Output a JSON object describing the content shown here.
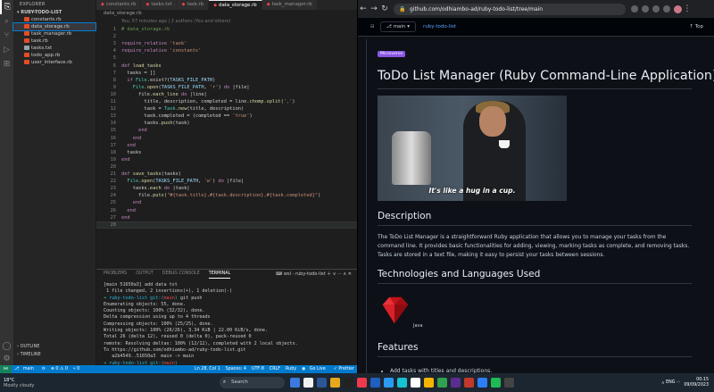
{
  "vscode": {
    "activity_icons": [
      "files-icon",
      "search-icon",
      "source-control-icon",
      "run-icon",
      "extensions-icon",
      "account-icon",
      "settings-icon"
    ],
    "explorer_title": "EXPLORER",
    "root_folder": "RUBY-TODO-LIST",
    "files": [
      {
        "name": "constants.rb",
        "color": "#e44d26"
      },
      {
        "name": "data_storage.rb",
        "color": "#e44d26",
        "selected": true
      },
      {
        "name": "task_manager.rb",
        "color": "#e44d26"
      },
      {
        "name": "task.rb",
        "color": "#e44d26"
      },
      {
        "name": "tasks.txt",
        "color": "#9aa3ab"
      },
      {
        "name": "todo_app.rb",
        "color": "#e44d26"
      },
      {
        "name": "user_interface.rb",
        "color": "#e44d26"
      }
    ],
    "outline_label": "OUTLINE",
    "timeline_label": "TIMELINE",
    "tabs": [
      {
        "label": "constants.rb"
      },
      {
        "label": "tasks.txt"
      },
      {
        "label": "task.rb"
      },
      {
        "label": "data_storage.rb",
        "active": true
      },
      {
        "label": "task_manager.rb"
      }
    ],
    "breadcrumb": "data_storage.rb",
    "blame": "You, 57 minutes ago | 2 authors (You and others)",
    "code_lines": [
      "# data_storage.rb",
      "",
      "require_relative 'task'",
      "require_relative 'constants'",
      "",
      "def load_tasks",
      "  tasks = []",
      "  if File.exist?(TASKS_FILE_PATH)",
      "    File.open(TASKS_FILE_PATH, 'r') do |file|",
      "      file.each_line do |line|",
      "        title, description, completed = line.chomp.split(',')",
      "        task = Task.new(title, description)",
      "        task.completed = (completed == 'true')",
      "        tasks.push(task)",
      "      end",
      "    end",
      "  end",
      "  tasks",
      "end",
      "",
      "def save_tasks(tasks)",
      "  File.open(TASKS_FILE_PATH, 'w') do |file|",
      "    tasks.each do |task|",
      "      file.puts(\"#{task.title},#{task.description},#{task.completed}\")",
      "    end",
      "  end",
      "end",
      ""
    ],
    "terminal_tabs": [
      "PROBLEMS",
      "OUTPUT",
      "DEBUG CONSOLE",
      "TERMINAL"
    ],
    "terminal_instance": "wsl - ruby-todo-list",
    "terminal_lines": [
      "[main 51650a3] add data txt",
      " 1 file changed, 2 insertions(+), 1 deletion(-)",
      "➜ ruby-todo-list git:(main) git push",
      "Enumerating objects: 55, done.",
      "Counting objects: 100% (32/32), done.",
      "Delta compression using up to 4 threads",
      "Compressing objects: 100% (25/25), done.",
      "Writing objects: 100% (26/26), 3.34 KiB | 22.00 KiB/s, done.",
      "Total 26 (delta 12), reused 0 (delta 0), pack-reused 0",
      "remote: Resolving deltas: 100% (12/12), completed with 2 local objects.",
      "To https://github.com/odhiambo-ad/ruby-todo-list.git",
      "   a2b4549..51650a3  main -> main",
      "➜ ruby-todo-list git:(main) "
    ],
    "status": {
      "remote": "⋈",
      "branch": "main",
      "sync": "⟳",
      "problems": "⊗ 0 ⚠ 0",
      "ports": "⑂ 0",
      "position": "Ln 28, Col 1",
      "spaces": "Spaces: 4",
      "encoding": "UTF-8",
      "eol": "CRLF",
      "language": "Ruby",
      "golive": "Go Live",
      "prettier": "✓ Prettier"
    }
  },
  "browser": {
    "url": "github.com/odhiambo-ad/ruby-todo-list/tree/main",
    "branch": "main",
    "repo": "ruby-todo-list",
    "top_label": "Top",
    "badge": "Microverse",
    "title": "ToDo List Manager (Ruby Command-Line Application)",
    "gif_caption": "It's like a hug in a cup.",
    "h_description": "Description",
    "description": "The ToDo List Manager is a straightforward Ruby application that allows you to manage your tasks from the command line. It provides basic functionalities for adding, viewing, marking tasks as complete, and removing tasks. Tasks are stored in a text file, making it easy to persist your tasks between sessions.",
    "h_tech": "Technologies and Languages Used",
    "tech_label": "Java",
    "h_features": "Features",
    "features": [
      "Add tasks with titles and descriptions."
    ]
  },
  "taskbar": {
    "temp": "18°C",
    "weather": "Mostly cloudy",
    "search": "Search",
    "time": "00:15",
    "date": "09/09/2023",
    "lang": "ENG",
    "app_colors": [
      "#3b7ae0",
      "#f0f0f0",
      "#2b5797",
      "#e8a81c",
      "#222",
      "#ee3a4b",
      "#1f5fbf",
      "#2b9af3",
      "#16c1d4",
      "#fff",
      "#f5b400",
      "#31a14d",
      "#5c2d91",
      "#c0392b",
      "#2d7df6",
      "#1db954",
      "#444"
    ]
  },
  "colors": {
    "accent": "#007acc",
    "github_bg": "#0d1117",
    "link": "#58a6ff",
    "badge": "#8957e5"
  }
}
